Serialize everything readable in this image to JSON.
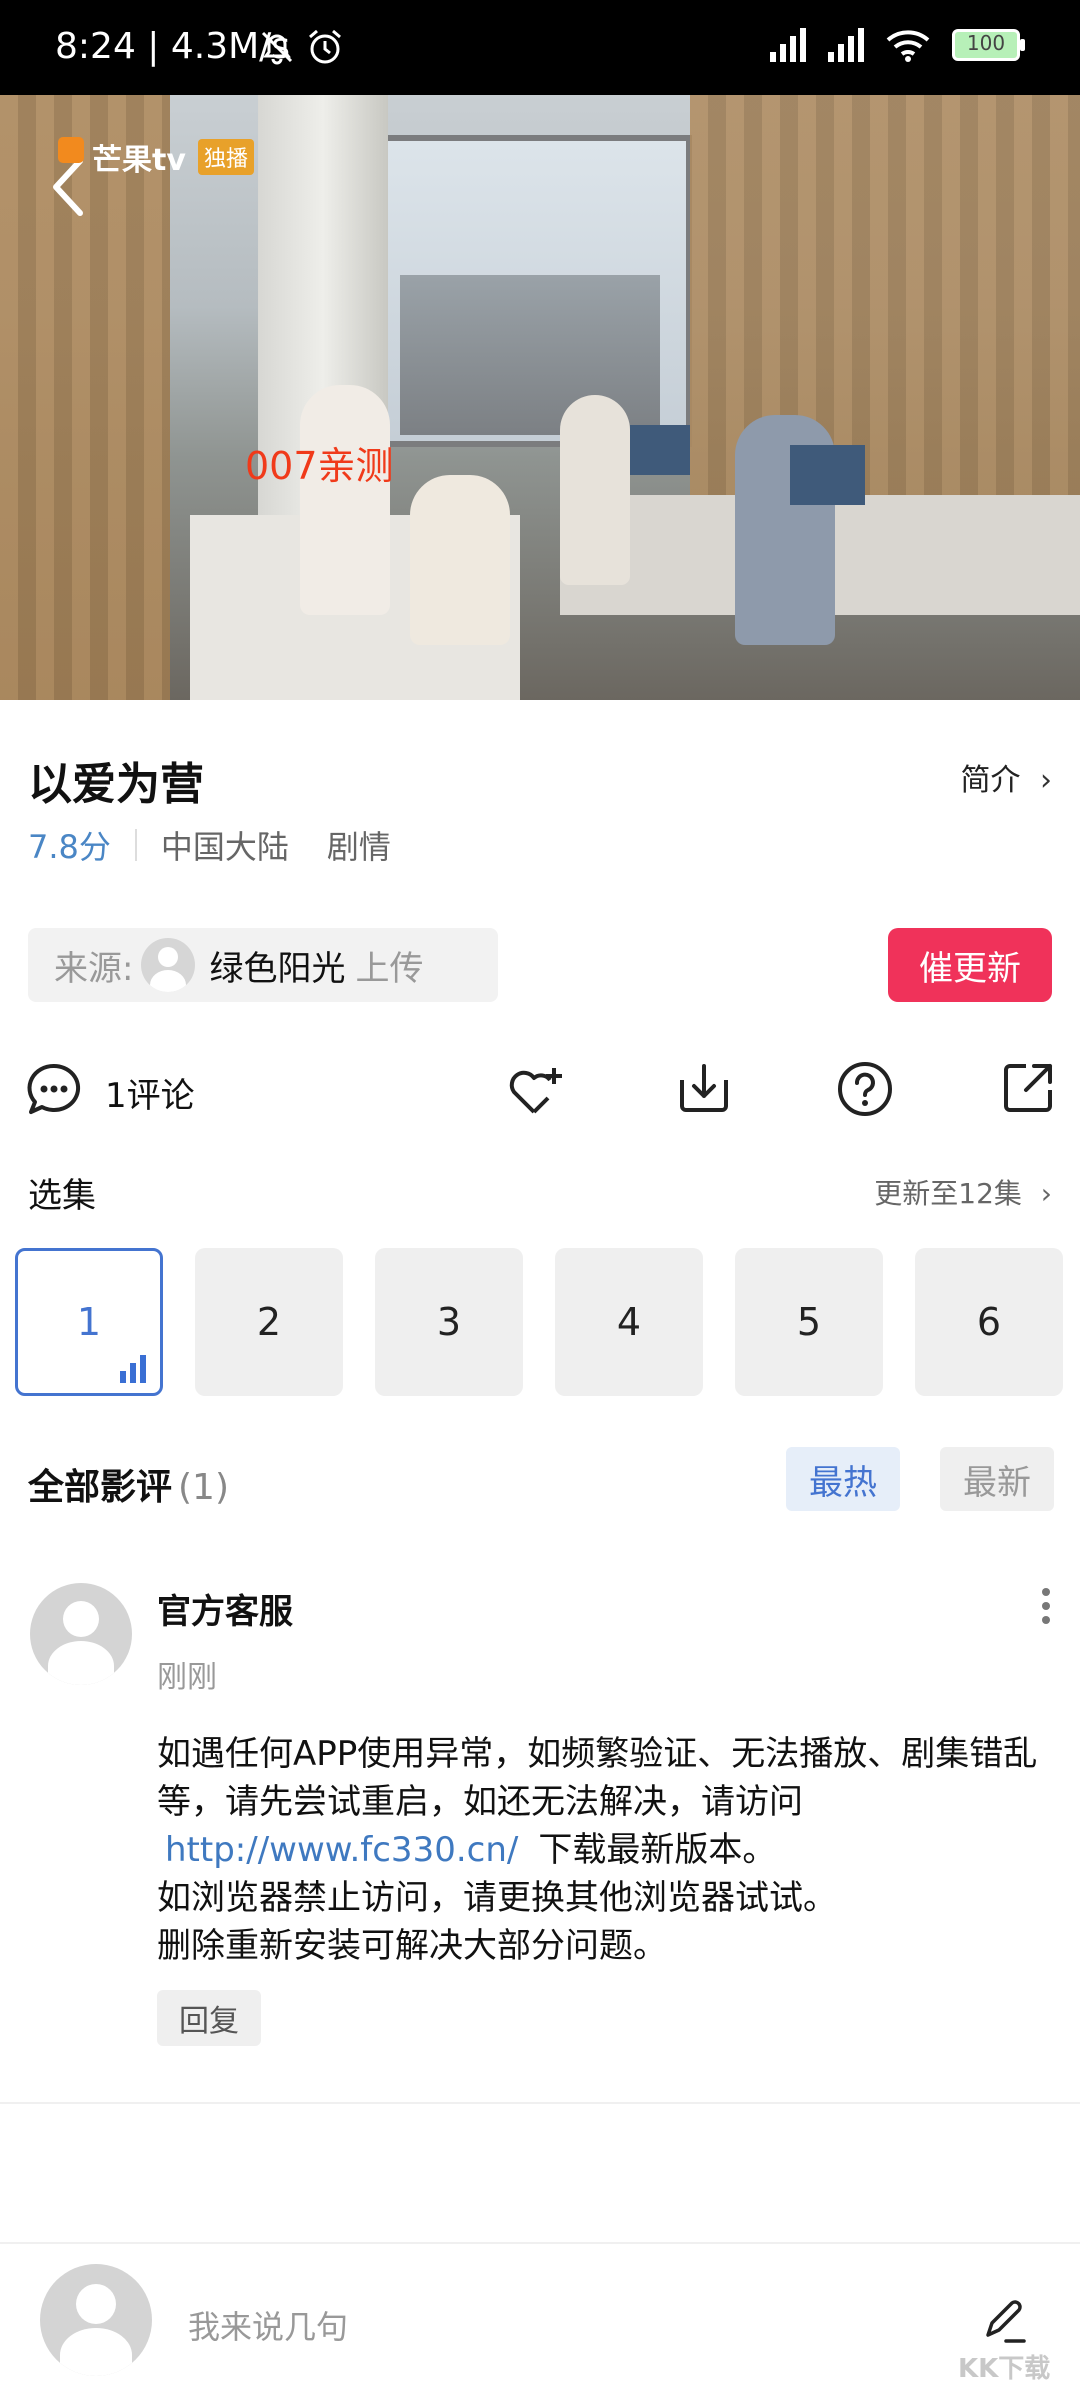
{
  "status_bar": {
    "time": "8:24 | 4.3M/s",
    "battery": "100"
  },
  "video": {
    "channel_logo": "芒果tv",
    "channel_tag": "独播",
    "overlay_text": "007亲测"
  },
  "show": {
    "title": "以爱为营",
    "intro_label": "简介",
    "score": "7.8分",
    "region": "中国大陆",
    "genre": "剧情"
  },
  "source": {
    "label": "来源:",
    "uploader": "绿色阳光",
    "suffix": "上传"
  },
  "urge_button": "催更新",
  "actions": {
    "comment_count": "1评论"
  },
  "episodes": {
    "section_title": "选集",
    "update_info": "更新至12集",
    "items": [
      "1",
      "2",
      "3",
      "4",
      "5",
      "6"
    ],
    "active": "1"
  },
  "reviews": {
    "title": "全部影评",
    "count": "(1)",
    "sort_hot": "最热",
    "sort_new": "最新",
    "comments": [
      {
        "author": "官方客服",
        "time": "刚刚",
        "line1": "如遇任何APP使用异常，如频繁验证、无法播放、剧集错乱等，请先尝试重启，如还无法解决，请访问",
        "link": "http://www.fc330.cn/",
        "line2": "下载最新版本。",
        "line3": "如浏览器禁止访问，请更换其他浏览器试试。",
        "line4": "删除重新安装可解决大部分问题。",
        "reply_label": "回复"
      }
    ]
  },
  "input": {
    "placeholder": "我来说几句"
  },
  "watermark": "KK下载",
  "colors": {
    "accent_red": "#f0325a",
    "accent_blue": "#4474d0",
    "link_blue": "#3f79c0"
  }
}
